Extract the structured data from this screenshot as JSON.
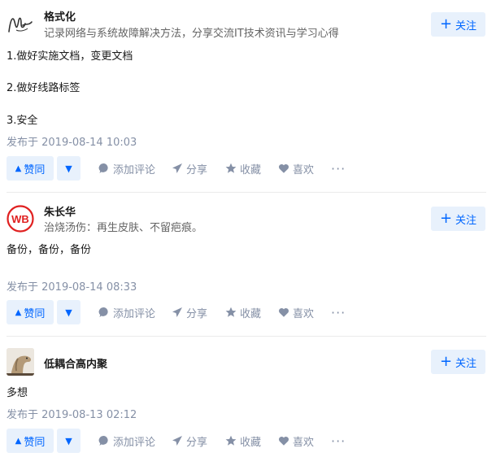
{
  "answers": [
    {
      "author": "格式化",
      "bio": "记录网络与系统故障解决方法，分享交流IT技术资讯与学习心得",
      "follow_label": "关注",
      "content": [
        "1.做好实施文档，变更文档",
        "2.做好线路标签",
        "3.安全"
      ],
      "time": "发布于 2019-08-14 10:03",
      "upvote_label": "赞同",
      "actions": {
        "comment": "添加评论",
        "share": "分享",
        "collect": "收藏",
        "like": "喜欢"
      }
    },
    {
      "author": "朱长华",
      "bio": "治烧汤伤：再生皮肤、不留疤痕。",
      "avatar_text": "WB",
      "follow_label": "关注",
      "content": [
        "备份，备份，备份"
      ],
      "time": "发布于 2019-08-14 08:33",
      "upvote_label": "赞同",
      "actions": {
        "comment": "添加评论",
        "share": "分享",
        "collect": "收藏",
        "like": "喜欢"
      }
    },
    {
      "author": "低耦合高内聚",
      "bio": "",
      "follow_label": "关注",
      "content": [
        "多想"
      ],
      "time": "发布于 2019-08-13 02:12",
      "upvote_label": "赞同",
      "actions": {
        "comment": "添加评论",
        "share": "分享",
        "collect": "收藏",
        "like": "喜欢"
      }
    }
  ],
  "colors": {
    "accent": "#0066ff",
    "accent_bg": "#e8f1fc",
    "meta": "#8590a6",
    "wb_red": "#e02020"
  },
  "icons": [
    "upvote-triangle-icon",
    "downvote-triangle-icon",
    "comment-bubble-icon",
    "share-plane-icon",
    "star-icon",
    "heart-icon",
    "more-ellipsis-icon",
    "plus-icon"
  ]
}
